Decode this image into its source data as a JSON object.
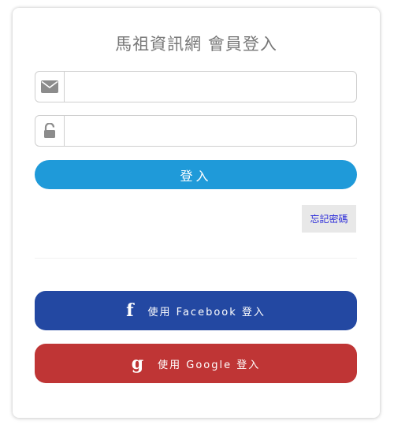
{
  "login": {
    "title": "馬祖資訊網 會員登入",
    "email_value": "",
    "password_value": "",
    "login_label": "登入",
    "forgot_label": "忘記密碼"
  },
  "social": {
    "facebook_label": "使用 Facebook 登入",
    "facebook_icon": "f",
    "google_label": "使用 Google 登入",
    "google_icon": "g"
  },
  "icons": {
    "email": "envelope-icon",
    "password": "unlock-icon",
    "facebook": "facebook-icon",
    "google": "google-icon"
  },
  "colors": {
    "primary": "#1f9ad9",
    "facebook": "#2348a2",
    "google": "#bf3535",
    "forgot_text": "#2a2ad8"
  }
}
